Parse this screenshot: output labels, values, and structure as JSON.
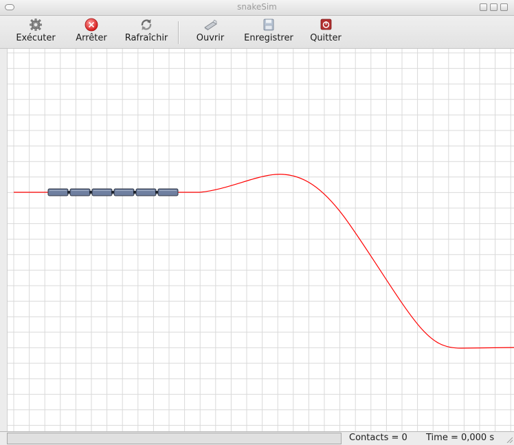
{
  "window": {
    "title": "snakeSim"
  },
  "toolbar": {
    "items": [
      {
        "label": "Exécuter",
        "icon": "gear-icon"
      },
      {
        "label": "Arrêter",
        "icon": "stop-icon"
      },
      {
        "label": "Rafraîchir",
        "icon": "refresh-icon"
      },
      {
        "label": "Ouvrir",
        "icon": "open-icon"
      },
      {
        "label": "Enregistrer",
        "icon": "save-icon"
      },
      {
        "label": "Quitter",
        "icon": "power-icon"
      }
    ]
  },
  "simulation": {
    "path_color": "#ff0000",
    "segment_color": "#6f7fa0",
    "grid_color": "#d9d9d9",
    "segments": 6
  },
  "status": {
    "contacts": "Contacts = 0",
    "time": "Time = 0,000 s"
  }
}
